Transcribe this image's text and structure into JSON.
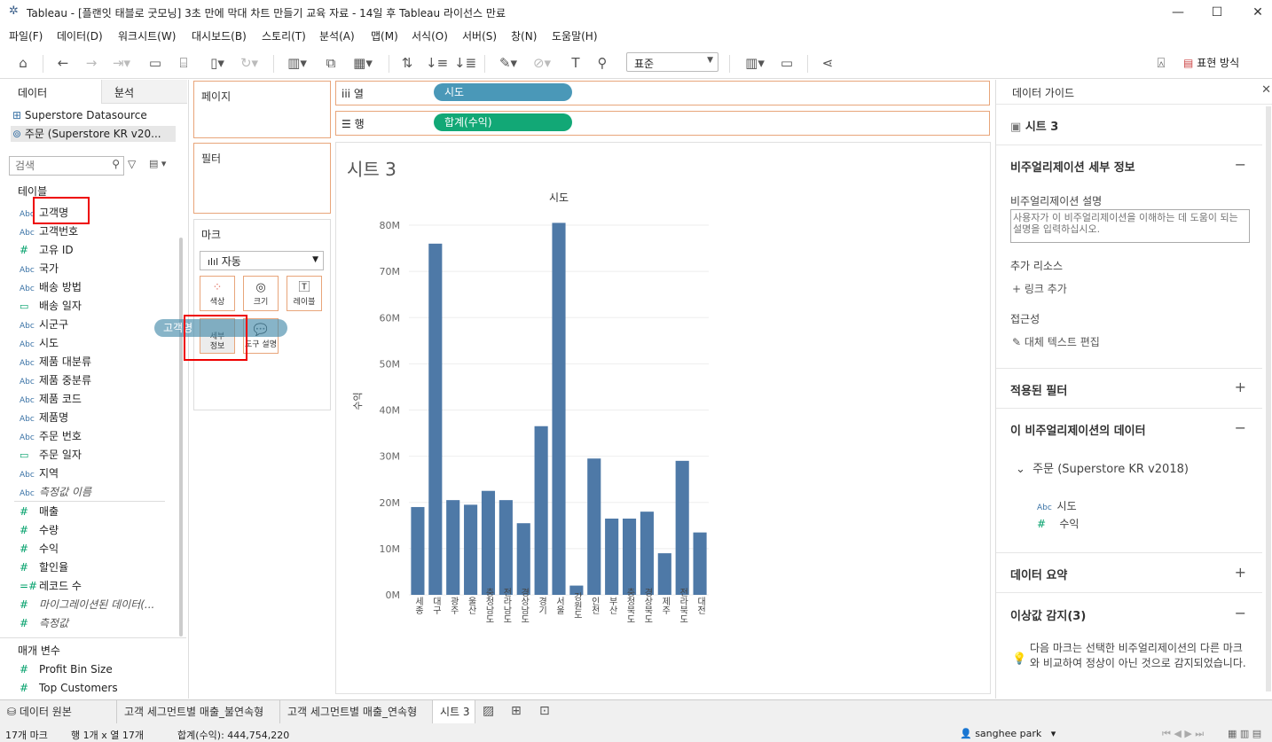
{
  "window": {
    "title": "Tableau - [플랜잇 태블로 굿모닝] 3초 만에 막대 차트 만들기 교육 자료 - 14일 후 Tableau 라이선스 만료",
    "buttons": [
      "minimize",
      "maximize",
      "close"
    ]
  },
  "menu": [
    "파일(F)",
    "데이터(D)",
    "워크시트(W)",
    "대시보드(B)",
    "스토리(T)",
    "분석(A)",
    "맵(M)",
    "서식(O)",
    "서버(S)",
    "창(N)",
    "도움말(H)"
  ],
  "toolbar": {
    "standard_select": "표준",
    "show_me": "표현 방식"
  },
  "data_pane": {
    "tab_data": "데이터",
    "tab_analysis": "분석",
    "datasources": [
      "Superstore Datasource",
      "주문 (Superstore KR v20..."
    ],
    "search_placeholder": "검색",
    "tables_heading": "테이블",
    "dimensions": [
      {
        "type": "Abc",
        "name": "고객명"
      },
      {
        "type": "Abc",
        "name": "고객번호"
      },
      {
        "type": "#",
        "name": "고유 ID"
      },
      {
        "type": "Abc",
        "name": "국가"
      },
      {
        "type": "Abc",
        "name": "배송 방법"
      },
      {
        "type": "date",
        "name": "배송 일자"
      },
      {
        "type": "Abc",
        "name": "시군구"
      },
      {
        "type": "Abc",
        "name": "시도"
      },
      {
        "type": "Abc",
        "name": "제품 대분류"
      },
      {
        "type": "Abc",
        "name": "제품 중분류"
      },
      {
        "type": "Abc",
        "name": "제품 코드"
      },
      {
        "type": "Abc",
        "name": "제품명"
      },
      {
        "type": "Abc",
        "name": "주문 번호"
      },
      {
        "type": "date",
        "name": "주문 일자"
      },
      {
        "type": "Abc",
        "name": "지역"
      },
      {
        "type": "Abc",
        "name": "측정값 이름",
        "italic": true
      }
    ],
    "measures": [
      {
        "type": "#",
        "name": "매출"
      },
      {
        "type": "#",
        "name": "수량"
      },
      {
        "type": "#",
        "name": "수익"
      },
      {
        "type": "#",
        "name": "할인율"
      },
      {
        "type": "=#",
        "name": "레코드 수"
      },
      {
        "type": "#",
        "name": "마이그레이션된 데이터(...",
        "italic": true
      },
      {
        "type": "#",
        "name": "측정값",
        "italic": true
      }
    ],
    "params_heading": "매개 변수",
    "params": [
      {
        "type": "#",
        "name": "Profit Bin Size"
      },
      {
        "type": "#",
        "name": "Top Customers"
      }
    ]
  },
  "shelves": {
    "pages": "페이지",
    "filters": "필터",
    "marks": "마크",
    "mark_type": "자동",
    "mark_buttons": [
      "색상",
      "크기",
      "레이블",
      "세부 정보",
      "도구 설명"
    ],
    "drag_pill": "고객명",
    "columns_label": "열",
    "rows_label": "행",
    "columns_pill": "시도",
    "rows_pill": "합계(수익)"
  },
  "view": {
    "sheet_title": "시트 3"
  },
  "chart_data": {
    "type": "bar",
    "title": "시도",
    "ylabel": "수익",
    "ylim": [
      0,
      80
    ],
    "yticks": [
      "0M",
      "10M",
      "20M",
      "30M",
      "40M",
      "50M",
      "60M",
      "70M",
      "80M"
    ],
    "categories": [
      "세종",
      "대구",
      "광주",
      "울산",
      "충청남도",
      "전라남도",
      "경상남도",
      "경기",
      "서울",
      "강원도",
      "인천",
      "부산",
      "충청북도",
      "경상북도",
      "제주",
      "전라북도",
      "대전"
    ],
    "values": [
      19,
      76,
      20.5,
      19.5,
      22.5,
      20.5,
      15.5,
      36.5,
      80.5,
      2,
      29.5,
      16.5,
      16.5,
      18,
      9,
      29,
      13.5
    ],
    "color": "#4e79a7"
  },
  "right_pane": {
    "title": "데이터 가이드",
    "sheet": "시트 3",
    "viz_detail": "비주얼리제이션 세부 정보",
    "desc_label": "비주얼리제이션 설명",
    "desc_placeholder": "사용자가 이 비주얼리제이션을 이해하는 데 도움이 되는 설명을 입력하십시오.",
    "extra_resources": "추가 리소스",
    "add_link": "링크 추가",
    "accessibility": "접근성",
    "edit_alt": "대체 텍스트 편집",
    "applied_filters": "적용된 필터",
    "viz_data": "이 비주얼리제이션의 데이터",
    "datasource": "주문 (Superstore KR v2018)",
    "data_fields": [
      {
        "type": "Abc",
        "name": "시도"
      },
      {
        "type": "#",
        "name": "수익"
      }
    ],
    "data_summary": "데이터 요약",
    "outliers": "이상값 감지(3)",
    "outlier_text": "다음 마크는 선택한 비주얼리제이션의 다른 마크와 비교하여 정상이 아닌 것으로 감지되었습니다."
  },
  "tabs": {
    "datasource": "데이터 원본",
    "sheets": [
      "고객 세그먼트별 매출_불연속형",
      "고객 세그먼트별 매출_연속형",
      "시트 3"
    ]
  },
  "status": {
    "marks": "17개 마크",
    "dims": "행 1개 x 열 17개",
    "sum": "합계(수익): 444,754,220",
    "user": "sanghee park"
  }
}
